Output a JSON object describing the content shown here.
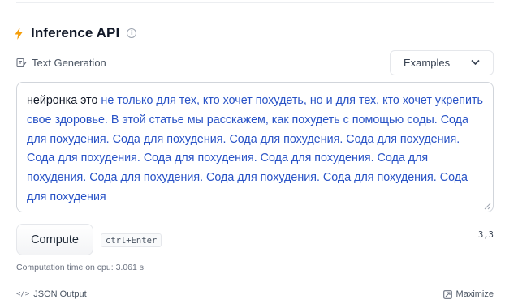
{
  "widget": {
    "title": "Inference API",
    "task_label": "Text Generation",
    "examples_label": "Examples"
  },
  "input": {
    "prompt_text": "нейронка это",
    "generated_text": " не только для тех, кто хочет похудеть, но и для тех, кто хочет укрепить свое здоровье. В этой статье мы расскажем, как похудеть с помощью соды. Сода для похудения. Сода для похудения. Сода для похудения. Сода для похудения. Сода для похудения. Сода для похудения. Сода для похудения. Сода для похудения. Сода для похудения. Сода для похудения. Сода для похудения. Сода для похудения"
  },
  "actions": {
    "compute_label": "Compute",
    "shortcut": "ctrl+Enter",
    "score": "3,3"
  },
  "status": {
    "computation_time": "Computation time on cpu: 3.061 s"
  },
  "footer": {
    "json_output_label": "JSON Output",
    "maximize_label": "Maximize"
  },
  "colors": {
    "accent_bolt": "#f59e0b",
    "generated_text": "#2953c6"
  },
  "icons": [
    "lightning-icon",
    "info-icon",
    "text-generation-icon",
    "chevron-down-icon",
    "resize-handle-icon",
    "code-icon",
    "maximize-icon"
  ]
}
